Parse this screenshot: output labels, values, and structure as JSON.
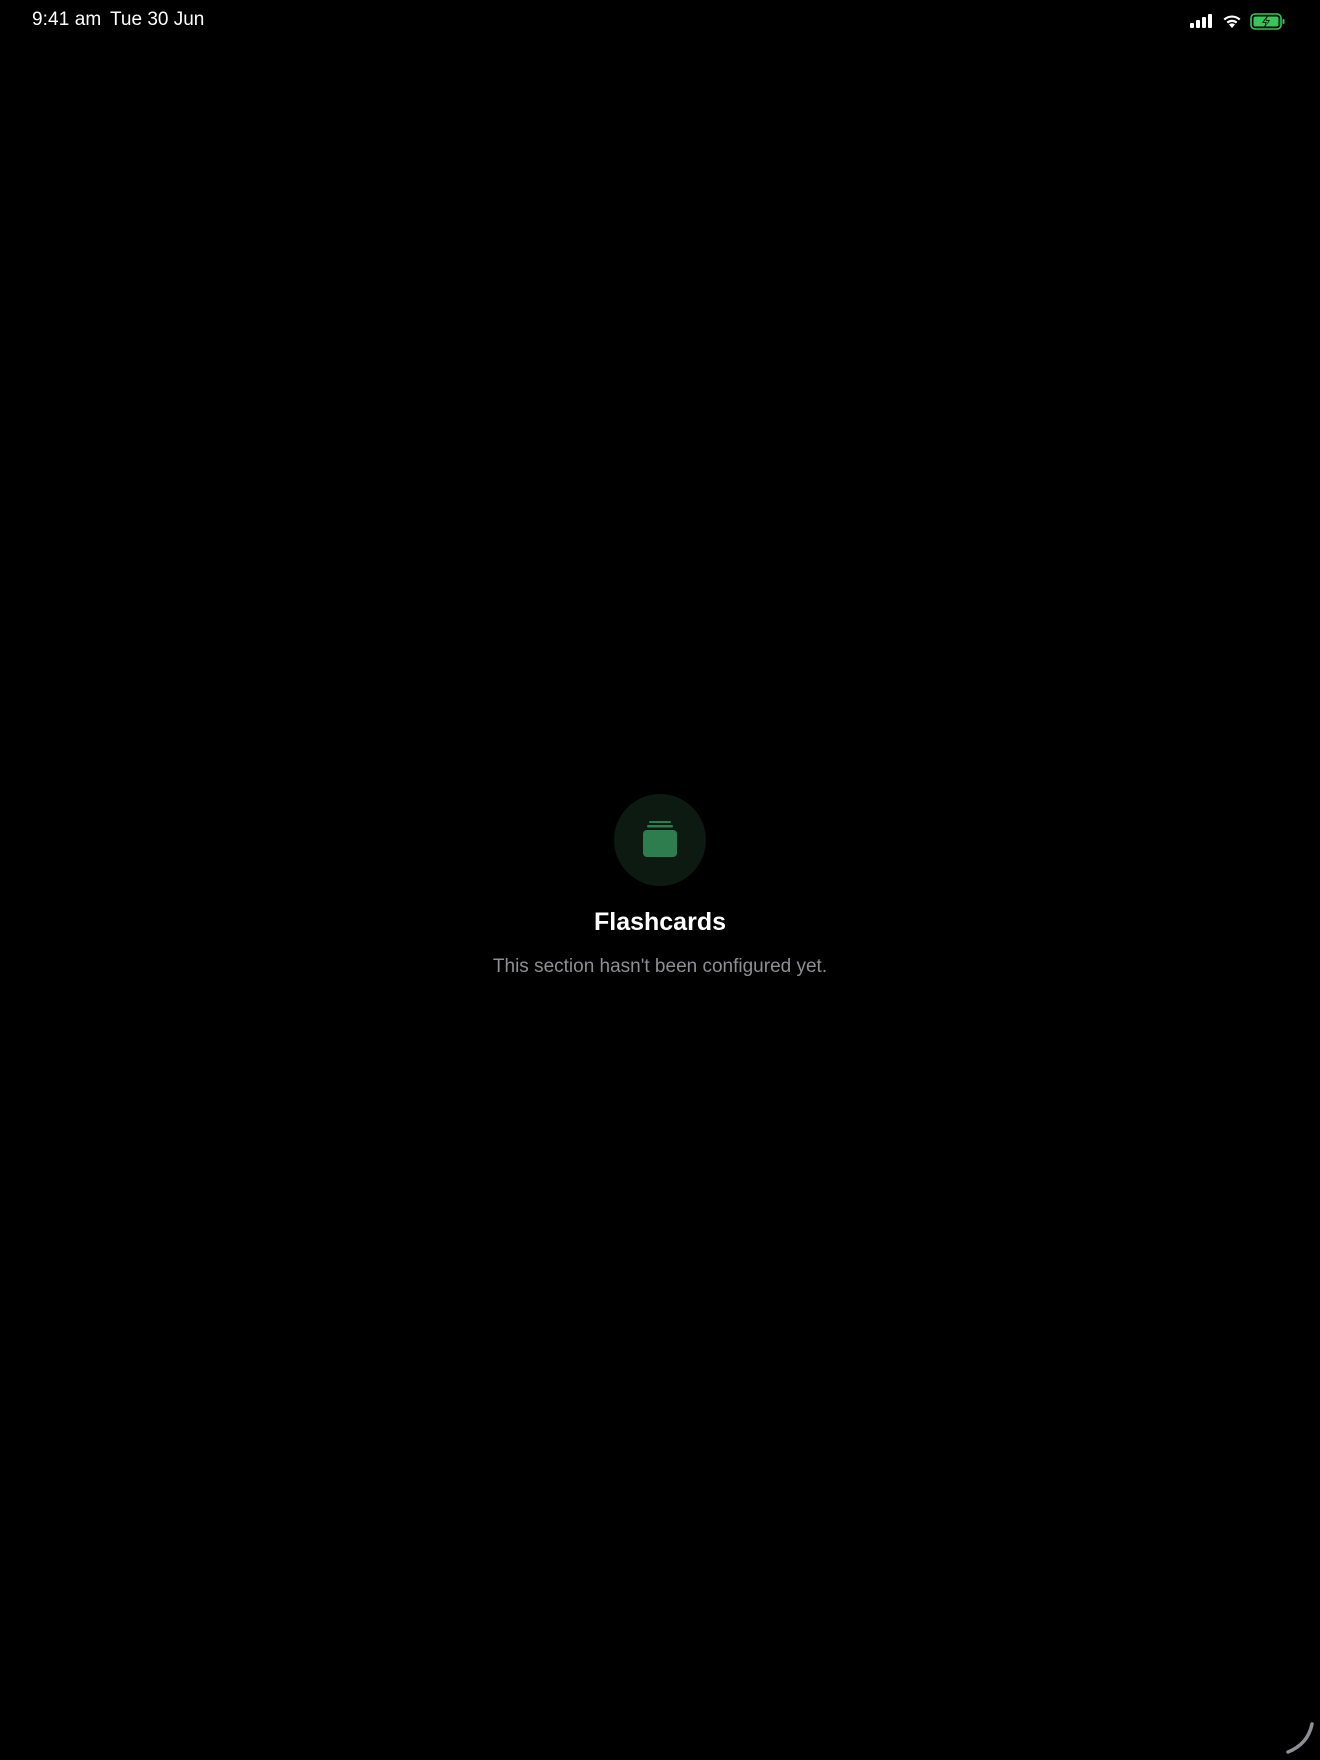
{
  "status_bar": {
    "time": "9:41 am",
    "date": "Tue 30 Jun",
    "icons": [
      "signal-icon",
      "wifi-icon",
      "battery-charging-icon"
    ],
    "battery_color": "#34c759"
  },
  "empty_state": {
    "icon": "flashcards-stack-icon",
    "accent_color": "#2e7d4f",
    "title": "Flashcards",
    "subtitle": "This section hasn't been configured yet."
  }
}
